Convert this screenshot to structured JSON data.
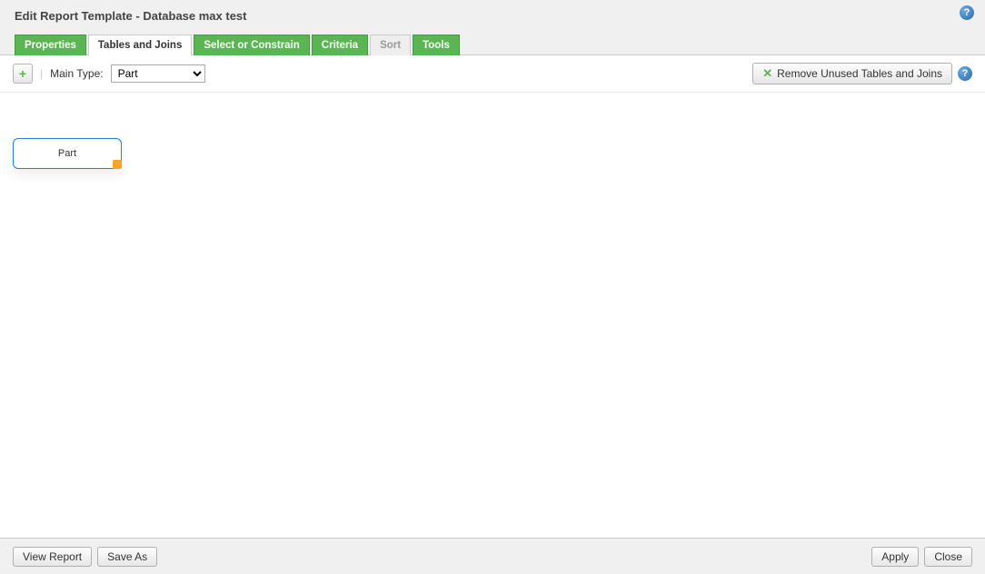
{
  "dialog": {
    "title": "Edit Report Template - Database max test"
  },
  "tabs": [
    {
      "label": "Properties",
      "state": "green"
    },
    {
      "label": "Tables and Joins",
      "state": "active"
    },
    {
      "label": "Select or Constrain",
      "state": "green"
    },
    {
      "label": "Criteria",
      "state": "green"
    },
    {
      "label": "Sort",
      "state": "grey"
    },
    {
      "label": "Tools",
      "state": "green"
    }
  ],
  "toolbar": {
    "main_type_label": "Main Type:",
    "main_type_value": "Part",
    "remove_unused_label": "Remove Unused Tables and Joins"
  },
  "canvas": {
    "entity_label": "Part"
  },
  "footer": {
    "view_report": "View Report",
    "save_as": "Save As",
    "apply": "Apply",
    "close": "Close"
  },
  "help_glyph": "?"
}
